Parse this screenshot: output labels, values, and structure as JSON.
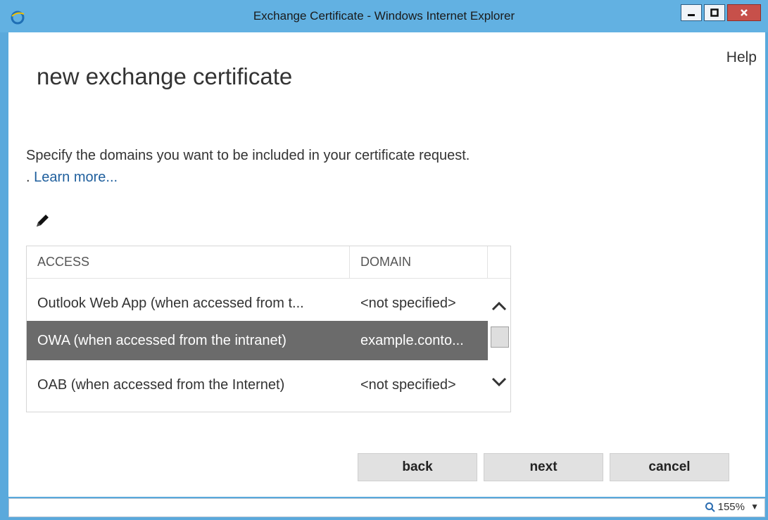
{
  "window": {
    "title": "Exchange Certificate - Windows Internet Explorer",
    "controls": [
      "minimize-icon",
      "maximize-icon",
      "close-icon"
    ]
  },
  "page": {
    "help_label": "Help",
    "title": "new exchange certificate",
    "description": "Specify the domains you want to be included in your certificate request. .",
    "learn_more": "Learn more..."
  },
  "toolbar": {
    "edit_icon": "pencil-icon"
  },
  "grid": {
    "columns": [
      "ACCESS",
      "DOMAIN"
    ],
    "rows": [
      {
        "access": "Outlook Web App (when accessed from t...",
        "domain": "<not specified>",
        "selected": false
      },
      {
        "access": "OWA (when accessed from the intranet)",
        "domain": "example.conto...",
        "selected": true
      },
      {
        "access": "OAB (when accessed from the Internet)",
        "domain": "<not specified>",
        "selected": false
      }
    ]
  },
  "buttons": {
    "back": "back",
    "next": "next",
    "cancel": "cancel"
  },
  "statusbar": {
    "zoom": "155%"
  },
  "colors": {
    "titlebar": "#62b1e2",
    "selected_row": "#6b6b6b",
    "link": "#1f5f9d",
    "close": "#c7504a"
  }
}
